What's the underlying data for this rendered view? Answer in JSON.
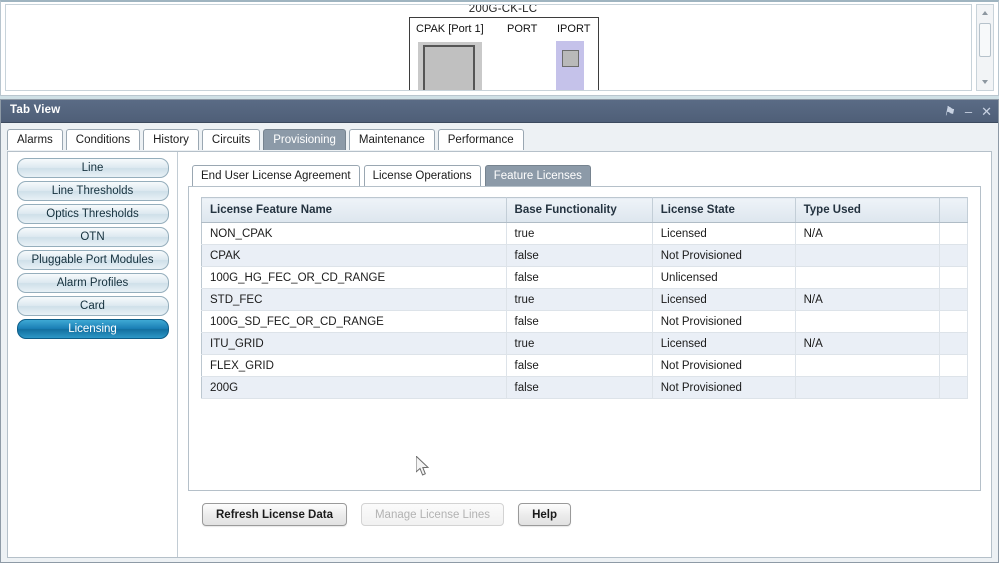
{
  "top_panel": {
    "card_title": "200G-CK-LC",
    "labels": {
      "cpak": "CPAK [Port 1]",
      "port": "PORT",
      "iport": "IPORT"
    }
  },
  "window": {
    "title": "Tab View",
    "controls": [
      {
        "name": "pin-icon",
        "glyph": "⚑"
      },
      {
        "name": "minimize-icon",
        "glyph": "–"
      },
      {
        "name": "close-icon",
        "glyph": "✕"
      }
    ]
  },
  "main_tabs": [
    {
      "label": "Alarms",
      "selected": false
    },
    {
      "label": "Conditions",
      "selected": false
    },
    {
      "label": "History",
      "selected": false
    },
    {
      "label": "Circuits",
      "selected": false
    },
    {
      "label": "Provisioning",
      "selected": true
    },
    {
      "label": "Maintenance",
      "selected": false
    },
    {
      "label": "Performance",
      "selected": false
    }
  ],
  "sidebar": {
    "items": [
      {
        "label": "Line",
        "active": false
      },
      {
        "label": "Line Thresholds",
        "active": false
      },
      {
        "label": "Optics Thresholds",
        "active": false
      },
      {
        "label": "OTN",
        "active": false
      },
      {
        "label": "Pluggable Port Modules",
        "active": false
      },
      {
        "label": "Alarm Profiles",
        "active": false
      },
      {
        "label": "Card",
        "active": false
      },
      {
        "label": "Licensing",
        "active": true
      }
    ]
  },
  "inner_tabs": [
    {
      "label": "End User License Agreement",
      "selected": false
    },
    {
      "label": "License Operations",
      "selected": false
    },
    {
      "label": "Feature Licenses",
      "selected": true
    }
  ],
  "table": {
    "columns": [
      "License Feature Name",
      "Base Functionality",
      "License State",
      "Type Used",
      ""
    ],
    "rows": [
      [
        "NON_CPAK",
        "true",
        "Licensed",
        "N/A",
        ""
      ],
      [
        "CPAK",
        "false",
        "Not Provisioned",
        "",
        ""
      ],
      [
        "100G_HG_FEC_OR_CD_RANGE",
        "false",
        "Unlicensed",
        "",
        ""
      ],
      [
        "STD_FEC",
        "true",
        "Licensed",
        "N/A",
        ""
      ],
      [
        "100G_SD_FEC_OR_CD_RANGE",
        "false",
        "Not Provisioned",
        "",
        ""
      ],
      [
        "ITU_GRID",
        "true",
        "Licensed",
        "N/A",
        ""
      ],
      [
        "FLEX_GRID",
        "false",
        "Not Provisioned",
        "",
        ""
      ],
      [
        "200G",
        "false",
        "Not Provisioned",
        "",
        ""
      ]
    ]
  },
  "buttons": {
    "refresh": "Refresh License Data",
    "manage": "Manage License Lines",
    "help": "Help"
  },
  "colors": {
    "titlebar": "#4f5f78",
    "tab_selected": "#8c9aa8",
    "sidebar_active": "#1a7fb5",
    "row_alt": "#eaeff6",
    "header_bg": "#dde6ee"
  }
}
